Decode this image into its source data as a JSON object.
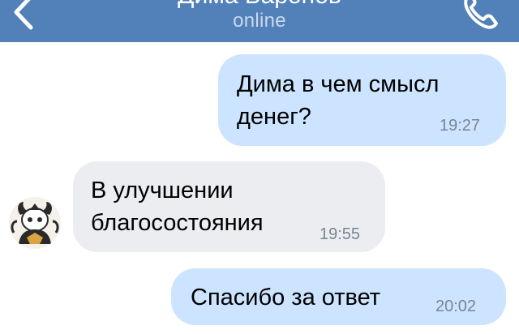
{
  "header": {
    "title": "Дима Баронов",
    "status": "online",
    "accent_color": "#5181b8",
    "back_icon": "chevron-left-icon",
    "call_icon": "phone-icon"
  },
  "messages": [
    {
      "direction": "outgoing",
      "text_line1": "Дима в чем смысл",
      "text_line2": "денег?",
      "time": "19:27"
    },
    {
      "direction": "incoming",
      "text_line1": "В улучшении",
      "text_line2": "благосостояния",
      "time": "19:55",
      "avatar_icon": "sticker-avatar-icon"
    },
    {
      "direction": "outgoing",
      "text_line1": "Спасибо за ответ",
      "time": "20:02"
    }
  ],
  "colors": {
    "outgoing_bubble": "#cce4ff",
    "incoming_bubble": "#ecedf1",
    "time_text": "#7a8591"
  }
}
